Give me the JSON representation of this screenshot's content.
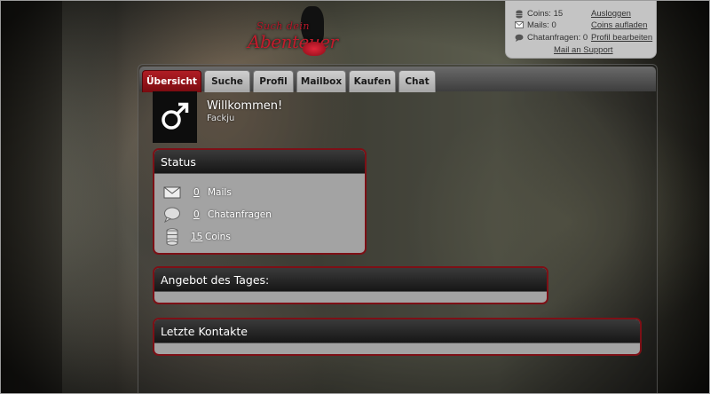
{
  "logo": {
    "line1": "Such dein",
    "line2": "Abenteuer"
  },
  "user_panel": {
    "coins": "Coins: 15",
    "mails": "Mails: 0",
    "chatanfragen": "Chatanfragen: 0",
    "links": [
      "Ausloggen",
      "Coins aufladen",
      "Profil bearbeiten"
    ],
    "support": "Mail an Support",
    "icons": [
      "coins-icon",
      "mail-icon",
      "chat-bubble-icon"
    ]
  },
  "tabs": [
    {
      "label": "Übersicht",
      "active": true
    },
    {
      "label": "Suche",
      "active": false
    },
    {
      "label": "Profil",
      "active": false
    },
    {
      "label": "Mailbox",
      "active": false
    },
    {
      "label": "Kaufen",
      "active": false
    },
    {
      "label": "Chat",
      "active": false
    }
  ],
  "welcome": {
    "title": "Willkommen!",
    "username": "Fackju",
    "avatar_icon": "male-symbol-icon"
  },
  "status": {
    "title": "Status",
    "rows": [
      {
        "icon": "mail-icon",
        "count": "0",
        "label": "Mails"
      },
      {
        "icon": "chat-bubble-icon",
        "count": "0",
        "label": "Chatanfragen"
      },
      {
        "icon": "coins-stack-icon",
        "count": "15",
        "label": "Coins"
      }
    ]
  },
  "offer": {
    "title": "Angebot des Tages:"
  },
  "contacts": {
    "title": "Letzte Kontakte"
  },
  "colors": {
    "accent_red": "#8a0d14",
    "tab_active": "#a01820",
    "panel_gray": "#a3a3a3"
  }
}
